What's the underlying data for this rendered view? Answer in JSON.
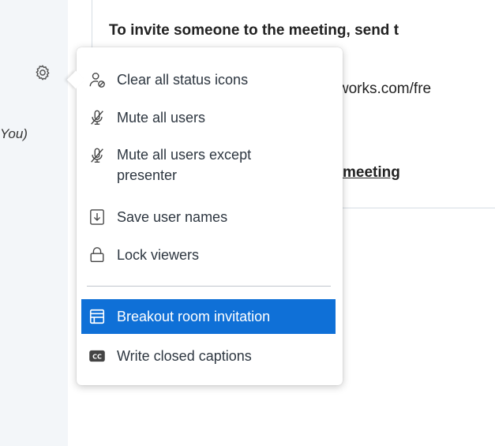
{
  "sidebar": {
    "user_label_fragment": "You)"
  },
  "chat": {
    "line1": "To invite someone to the meeting, send t",
    "line2": "etworks.com/fre",
    "line3": "meeting"
  },
  "menu": {
    "items": [
      {
        "label": "Clear all status icons",
        "icon": "clear-status-icon"
      },
      {
        "label": "Mute all users",
        "icon": "mute-icon"
      },
      {
        "label": "Mute all users except presenter",
        "icon": "mute-icon"
      },
      {
        "label": "Save user names",
        "icon": "save-icon"
      },
      {
        "label": "Lock viewers",
        "icon": "lock-icon"
      },
      {
        "label": "Breakout room invitation",
        "icon": "breakout-room-icon",
        "active": true
      },
      {
        "label": "Write closed captions",
        "icon": "closed-captions-icon"
      }
    ]
  },
  "colors": {
    "accent": "#0f70d7",
    "sidebar_bg": "#f3f6f9"
  }
}
